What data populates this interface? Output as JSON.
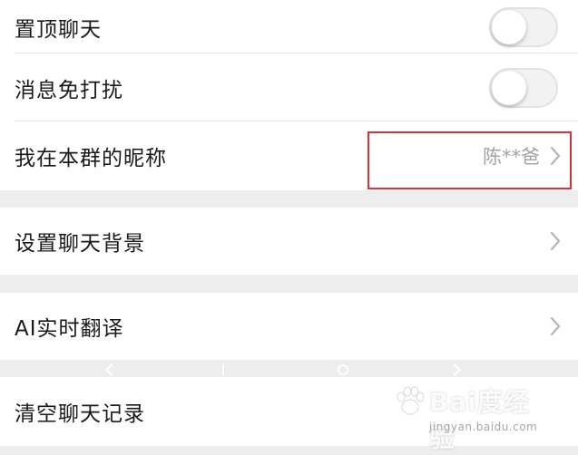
{
  "settings": {
    "pin_chat": {
      "label": "置顶聊天",
      "enabled": false
    },
    "mute_notifications": {
      "label": "消息免打扰",
      "enabled": false
    },
    "group_nickname": {
      "label": "我在本群的昵称",
      "value": "陈**爸"
    },
    "chat_background": {
      "label": "设置聊天背景"
    },
    "ai_translate": {
      "label": "AI实时翻译"
    },
    "clear_history": {
      "label": "清空聊天记录"
    }
  },
  "icons": {
    "chevron": "chevron-right-icon",
    "watermark_logo": "paw-logo-icon"
  },
  "colors": {
    "highlight": "#d9303b",
    "value_text": "#a3a3a3",
    "background": "#ededed"
  },
  "watermark": {
    "brand": "Bai度经验",
    "url": "jingyan.baidu.com"
  }
}
